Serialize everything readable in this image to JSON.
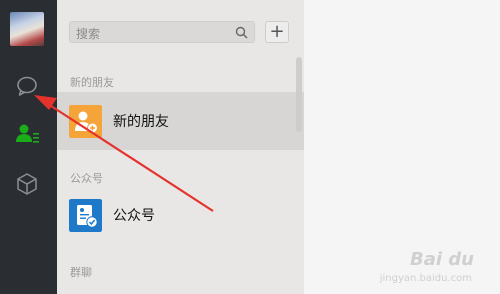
{
  "search": {
    "placeholder": "搜索"
  },
  "toolbar": {
    "add_label": "+"
  },
  "sections": {
    "new_friends_header": "新的朋友",
    "official_header": "公众号",
    "groups_header": "群聊"
  },
  "rows": {
    "new_friends": "新的朋友",
    "official_accounts": "公众号"
  },
  "icons": {
    "chat": "chat-bubble-icon",
    "contacts": "contacts-icon",
    "favorites": "cube-icon",
    "search": "search-icon",
    "new_friend": "add-friend-icon",
    "official": "official-account-icon"
  },
  "colors": {
    "rail_bg": "#2a2d31",
    "list_bg": "#e8e7e6",
    "contacts_active": "#1aad19",
    "new_friend_icon": "#f5a43a",
    "official_icon": "#1e79c8",
    "annotation_arrow": "#e5322d"
  },
  "watermark": {
    "brand": "Bai du",
    "sub": "jingyan.baidu.com"
  }
}
